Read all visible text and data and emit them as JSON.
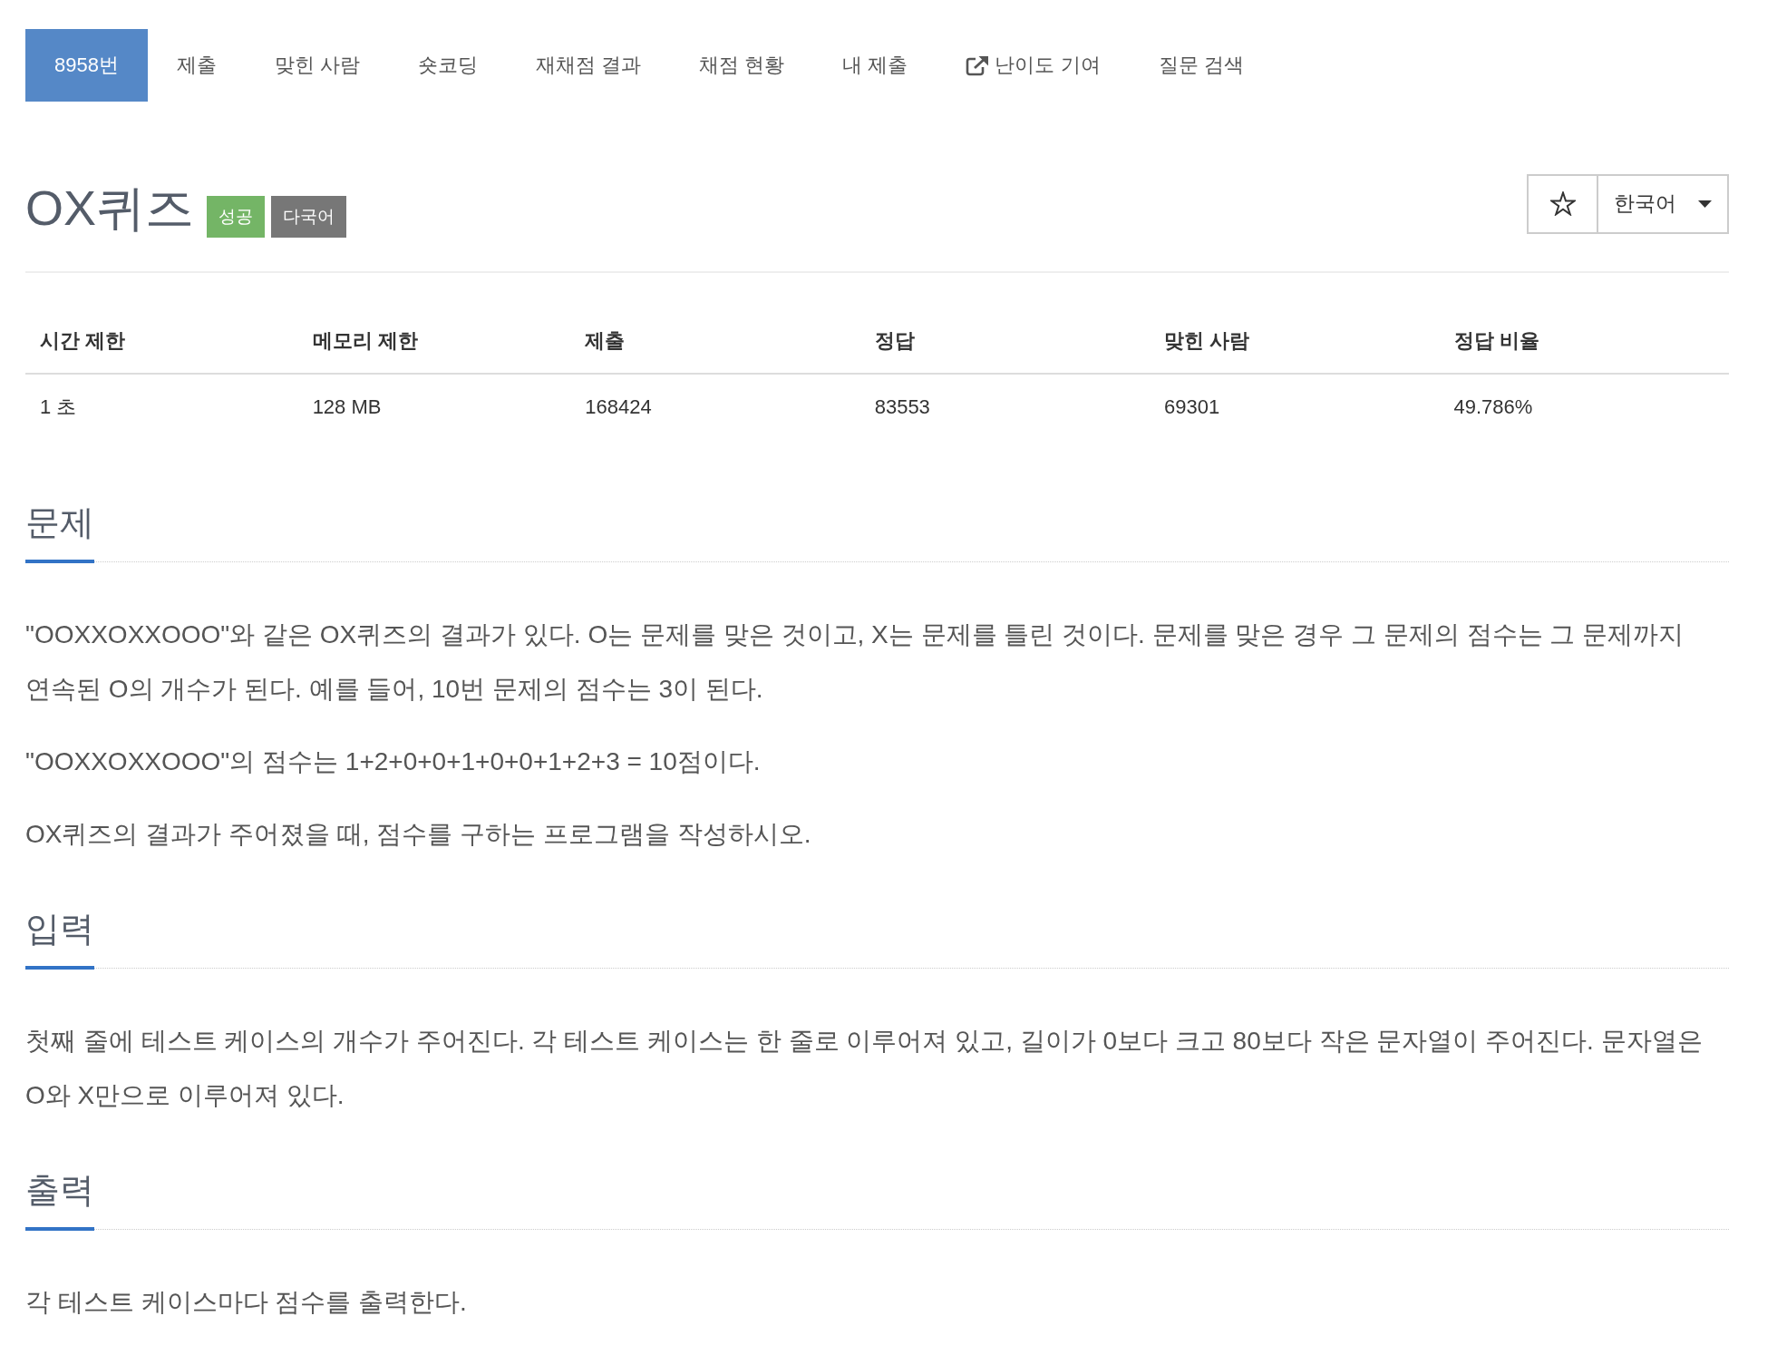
{
  "tabs": [
    {
      "label": "8958번",
      "selected": true,
      "kind": "page"
    },
    {
      "label": "제출",
      "selected": false,
      "kind": "page"
    },
    {
      "label": "맞힌 사람",
      "selected": false,
      "kind": "page"
    },
    {
      "label": "숏코딩",
      "selected": false,
      "kind": "page"
    },
    {
      "label": "재채점 결과",
      "selected": false,
      "kind": "page"
    },
    {
      "label": "채점 현황",
      "selected": false,
      "kind": "page"
    },
    {
      "label": "내 제출",
      "selected": false,
      "kind": "page"
    },
    {
      "label": "난이도 기여",
      "selected": false,
      "kind": "external"
    },
    {
      "label": "질문 검색",
      "selected": false,
      "kind": "page"
    }
  ],
  "problem": {
    "title": "OX퀴즈",
    "badges": [
      {
        "label": "성공",
        "color": "#74b566"
      },
      {
        "label": "다국어",
        "color": "#777777"
      }
    ]
  },
  "favorite": {
    "starred": false
  },
  "language_select": {
    "value": "한국어"
  },
  "limits_table": {
    "columns": [
      "시간 제한",
      "메모리 제한",
      "제출",
      "정답",
      "맞힌 사람",
      "정답 비율"
    ],
    "rows": [
      [
        "1 초",
        "128 MB",
        "168424",
        "83553",
        "69301",
        "49.786%"
      ]
    ]
  },
  "sections": [
    {
      "heading": "문제",
      "paragraphs": [
        "\"OOXXOXXOOO\"와 같은 OX퀴즈의 결과가 있다. O는 문제를 맞은 것이고, X는 문제를 틀린 것이다. 문제를 맞은 경우 그 문제의 점수는 그 문제까지 연속된 O의 개수가 된다. 예를 들어, 10번 문제의 점수는 3이 된다.",
        "\"OOXXOXXOOO\"의 점수는 1+2+0+0+1+0+0+1+2+3 = 10점이다.",
        "OX퀴즈의 결과가 주어졌을 때, 점수를 구하는 프로그램을 작성하시오."
      ]
    },
    {
      "heading": "입력",
      "paragraphs": [
        "첫째 줄에 테스트 케이스의 개수가 주어진다. 각 테스트 케이스는 한 줄로 이루어져 있고, 길이가 0보다 크고 80보다 작은 문자열이 주어진다. 문자열은 O와 X만으로 이루어져 있다."
      ]
    },
    {
      "heading": "출력",
      "paragraphs": [
        "각 테스트 케이스마다 점수를 출력한다."
      ]
    }
  ]
}
